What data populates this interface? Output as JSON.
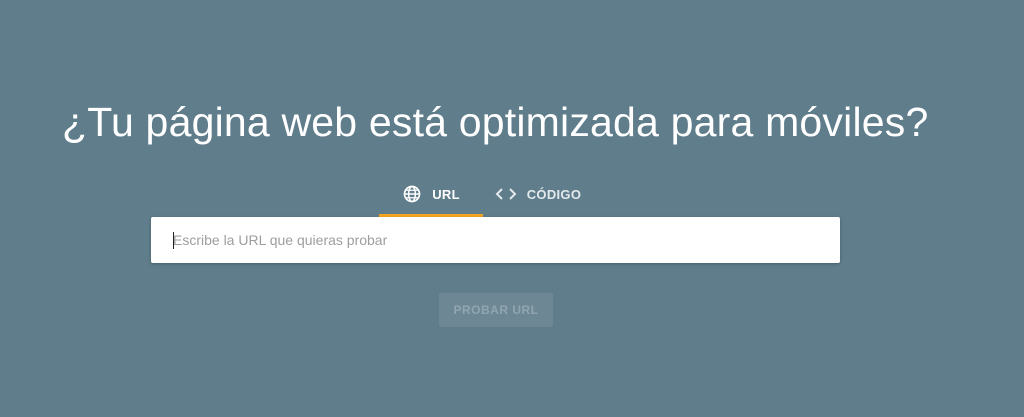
{
  "page": {
    "headline": "¿Tu página web está optimizada para móviles?",
    "background_color": "#607d8b"
  },
  "tabs": [
    {
      "label": "URL",
      "icon": "globe-icon",
      "selected": true,
      "indicator_color": "#f4a522"
    },
    {
      "label": "CÓDIGO",
      "icon": "code-brackets-icon",
      "selected": false
    }
  ],
  "url_input": {
    "value": "",
    "placeholder": "Escribe la URL que quieras probar"
  },
  "submit_button": {
    "label": "PROBAR URL",
    "enabled": false
  }
}
